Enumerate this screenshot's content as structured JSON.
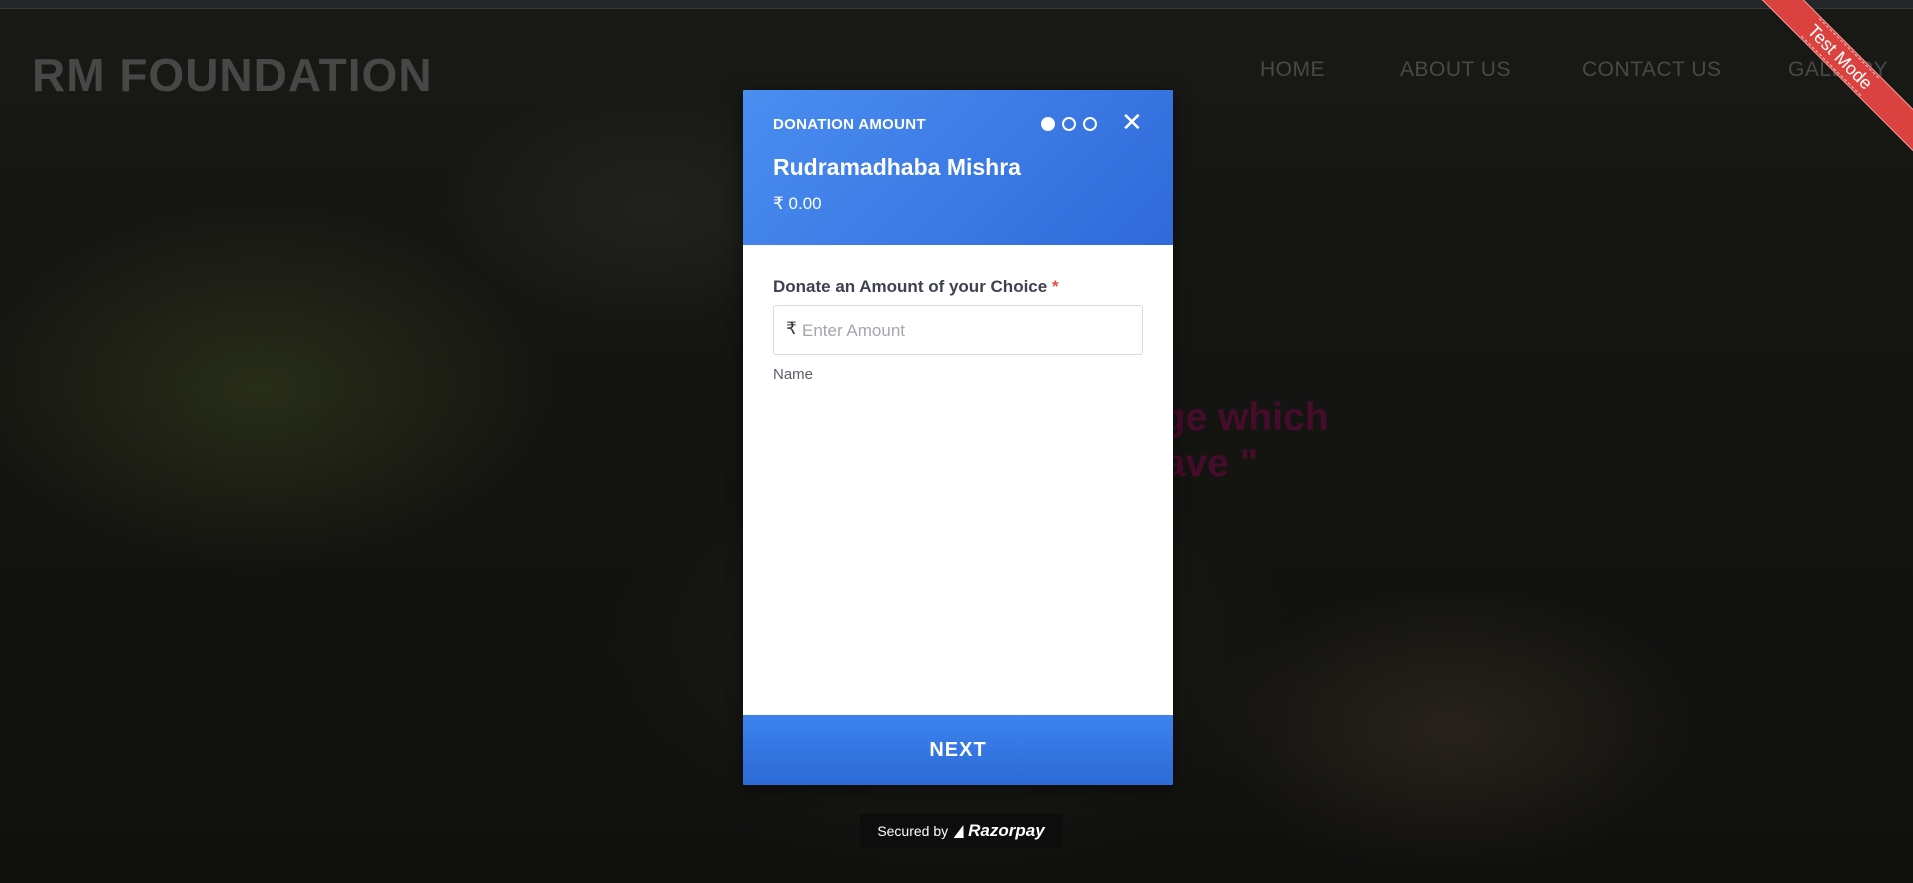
{
  "site": {
    "brand": "RM FOUNDATION",
    "nav": [
      "HOME",
      "ABOUT US",
      "CONTACT US",
      "GALLERY"
    ],
    "quote_line1": "ege which",
    "quote_line2": "have \"",
    "test_ribbon": "Test Mode"
  },
  "modal": {
    "step_title": "DONATION AMOUNT",
    "payee": "Rudramadhaba Mishra",
    "amount_display": "₹ 0.00",
    "close_symbol": "✕",
    "steps": {
      "total": 3,
      "current": 1
    },
    "amount_label": "Donate an Amount of your Choice",
    "required_mark": "*",
    "currency_symbol": "₹",
    "amount_placeholder": "Enter Amount",
    "name_label": "Name",
    "next_label": "NEXT"
  },
  "footer": {
    "secured_by": "Secured by",
    "provider": "Razorpay"
  },
  "colors": {
    "header_blue": "#3a78e4",
    "next_blue": "#2d6ad6",
    "ribbon_red": "#d9423f",
    "quote_color": "#6e1242",
    "required_red": "#e74c4c"
  },
  "icons": [
    "close-icon",
    "step-dot-icon",
    "rupee-icon",
    "razorpay-logo-icon"
  ]
}
